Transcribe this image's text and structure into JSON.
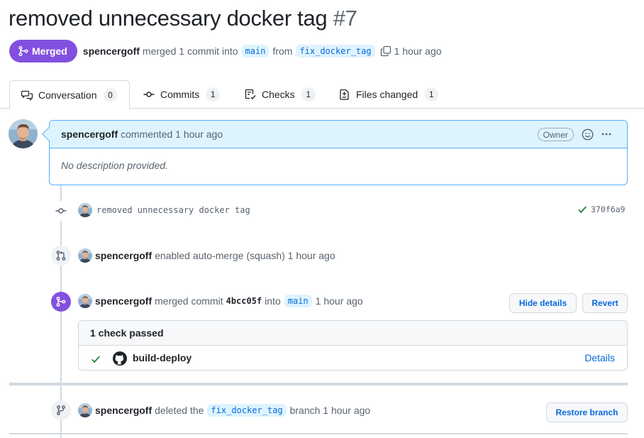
{
  "pr": {
    "title": "removed unnecessary docker tag",
    "number": "#7",
    "state": "Merged",
    "author": "spencergoff",
    "merge_text": "merged 1 commit into",
    "base_branch": "main",
    "from_text": "from",
    "head_branch": "fix_docker_tag",
    "time": "1 hour ago"
  },
  "tabs": [
    {
      "label": "Conversation",
      "count": "0",
      "icon": "comment-discussion-icon",
      "active": true
    },
    {
      "label": "Commits",
      "count": "1",
      "icon": "git-commit-icon"
    },
    {
      "label": "Checks",
      "count": "1",
      "icon": "checklist-icon"
    },
    {
      "label": "Files changed",
      "count": "1",
      "icon": "file-diff-icon"
    }
  ],
  "comment": {
    "author": "spencergoff",
    "action": "commented 1 hour ago",
    "badge": "Owner",
    "body": "No description provided."
  },
  "timeline": {
    "commit": {
      "message": "removed unnecessary docker tag",
      "sha": "370f6a9"
    },
    "automerge": {
      "author": "spencergoff",
      "text": "enabled auto-merge (squash) 1 hour ago"
    },
    "merged": {
      "author": "spencergoff",
      "text_before": "merged commit",
      "sha": "4bcc05f",
      "into": "into",
      "branch": "main",
      "time": "1 hour ago",
      "hide_details": "Hide details",
      "revert": "Revert"
    },
    "checks": {
      "summary": "1 check passed",
      "name": "build-deploy",
      "details": "Details"
    },
    "deleted": {
      "author": "spencergoff",
      "text_before": "deleted the",
      "branch": "fix_docker_tag",
      "text_after": "branch 1 hour ago",
      "restore": "Restore branch"
    }
  },
  "colors": {
    "merged_purple": "#8250df",
    "link_blue": "#0969da",
    "branch_bg": "#ddf4ff",
    "success_green": "#1a7f37"
  }
}
